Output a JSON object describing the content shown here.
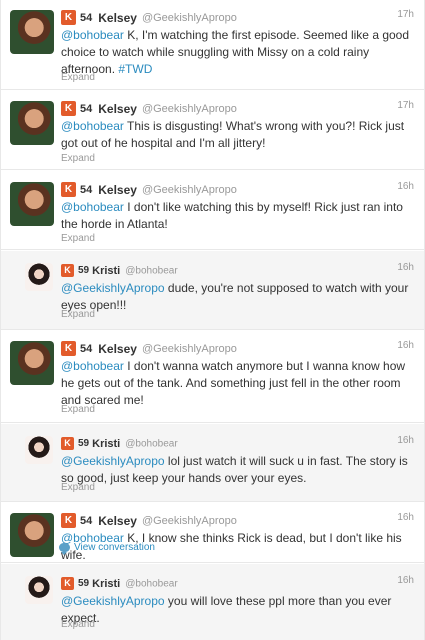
{
  "tweets": [
    {
      "name": "Kelsey",
      "username": "@GeekishlyApropo",
      "score": "54",
      "time": "17h",
      "mention": "@bohobear",
      "text": " K, I'm watching the first episode. Seemed like a good choice to watch while snuggling with Missy on a cold rainy afternoon. ",
      "hashtag": "#TWD",
      "action": "Expand"
    },
    {
      "name": "Kelsey",
      "username": "@GeekishlyApropo",
      "score": "54",
      "time": "17h",
      "mention": "@bohobear",
      "text": " This is disgusting! What's wrong with you?! Rick just got out of he hospital and I'm all jittery!",
      "action": "Expand"
    },
    {
      "name": "Kelsey",
      "username": "@GeekishlyApropo",
      "score": "54",
      "time": "16h",
      "mention": "@bohobear",
      "text": " I don't like watching this by myself! Rick just ran into the horde in Atlanta!",
      "action": "Expand"
    },
    {
      "name": "Kristi",
      "username": "@bohobear",
      "score": "59",
      "time": "16h",
      "mention": "@GeekishlyApropo",
      "text": " dude, you're not supposed to watch with your eyes open!!!",
      "action": "Expand"
    },
    {
      "name": "Kelsey",
      "username": "@GeekishlyApropo",
      "score": "54",
      "time": "16h",
      "mention": "@bohobear",
      "text": " I don't wanna watch anymore but I wanna know how he gets out of the tank. And something just fell in the other room and scared me!",
      "action": "Expand"
    },
    {
      "name": "Kristi",
      "username": "@bohobear",
      "score": "59",
      "time": "16h",
      "mention": "@GeekishlyApropo",
      "text": " lol just watch it will suck u in fast. The story is so good, just keep your hands over your eyes.",
      "action": "Expand"
    },
    {
      "name": "Kelsey",
      "username": "@GeekishlyApropo",
      "score": "54",
      "time": "16h",
      "mention": "@bohobear",
      "text": " K, I know she thinks Rick is dead, but I don't like his wife.",
      "action": "View conversation"
    },
    {
      "name": "Kristi",
      "username": "@bohobear",
      "score": "59",
      "time": "16h",
      "mention": "@GeekishlyApropo",
      "text": " you will love these ppl more than you ever expect.",
      "action": "Expand"
    }
  ],
  "colors": {
    "link": "#2a8bbf",
    "klout": "#e25b2b",
    "muted": "#999999",
    "reply_bg": "#f5f5f5"
  },
  "icons": {
    "klout": "klout-icon",
    "conversation": "conversation-icon"
  },
  "klout_glyph": "K"
}
